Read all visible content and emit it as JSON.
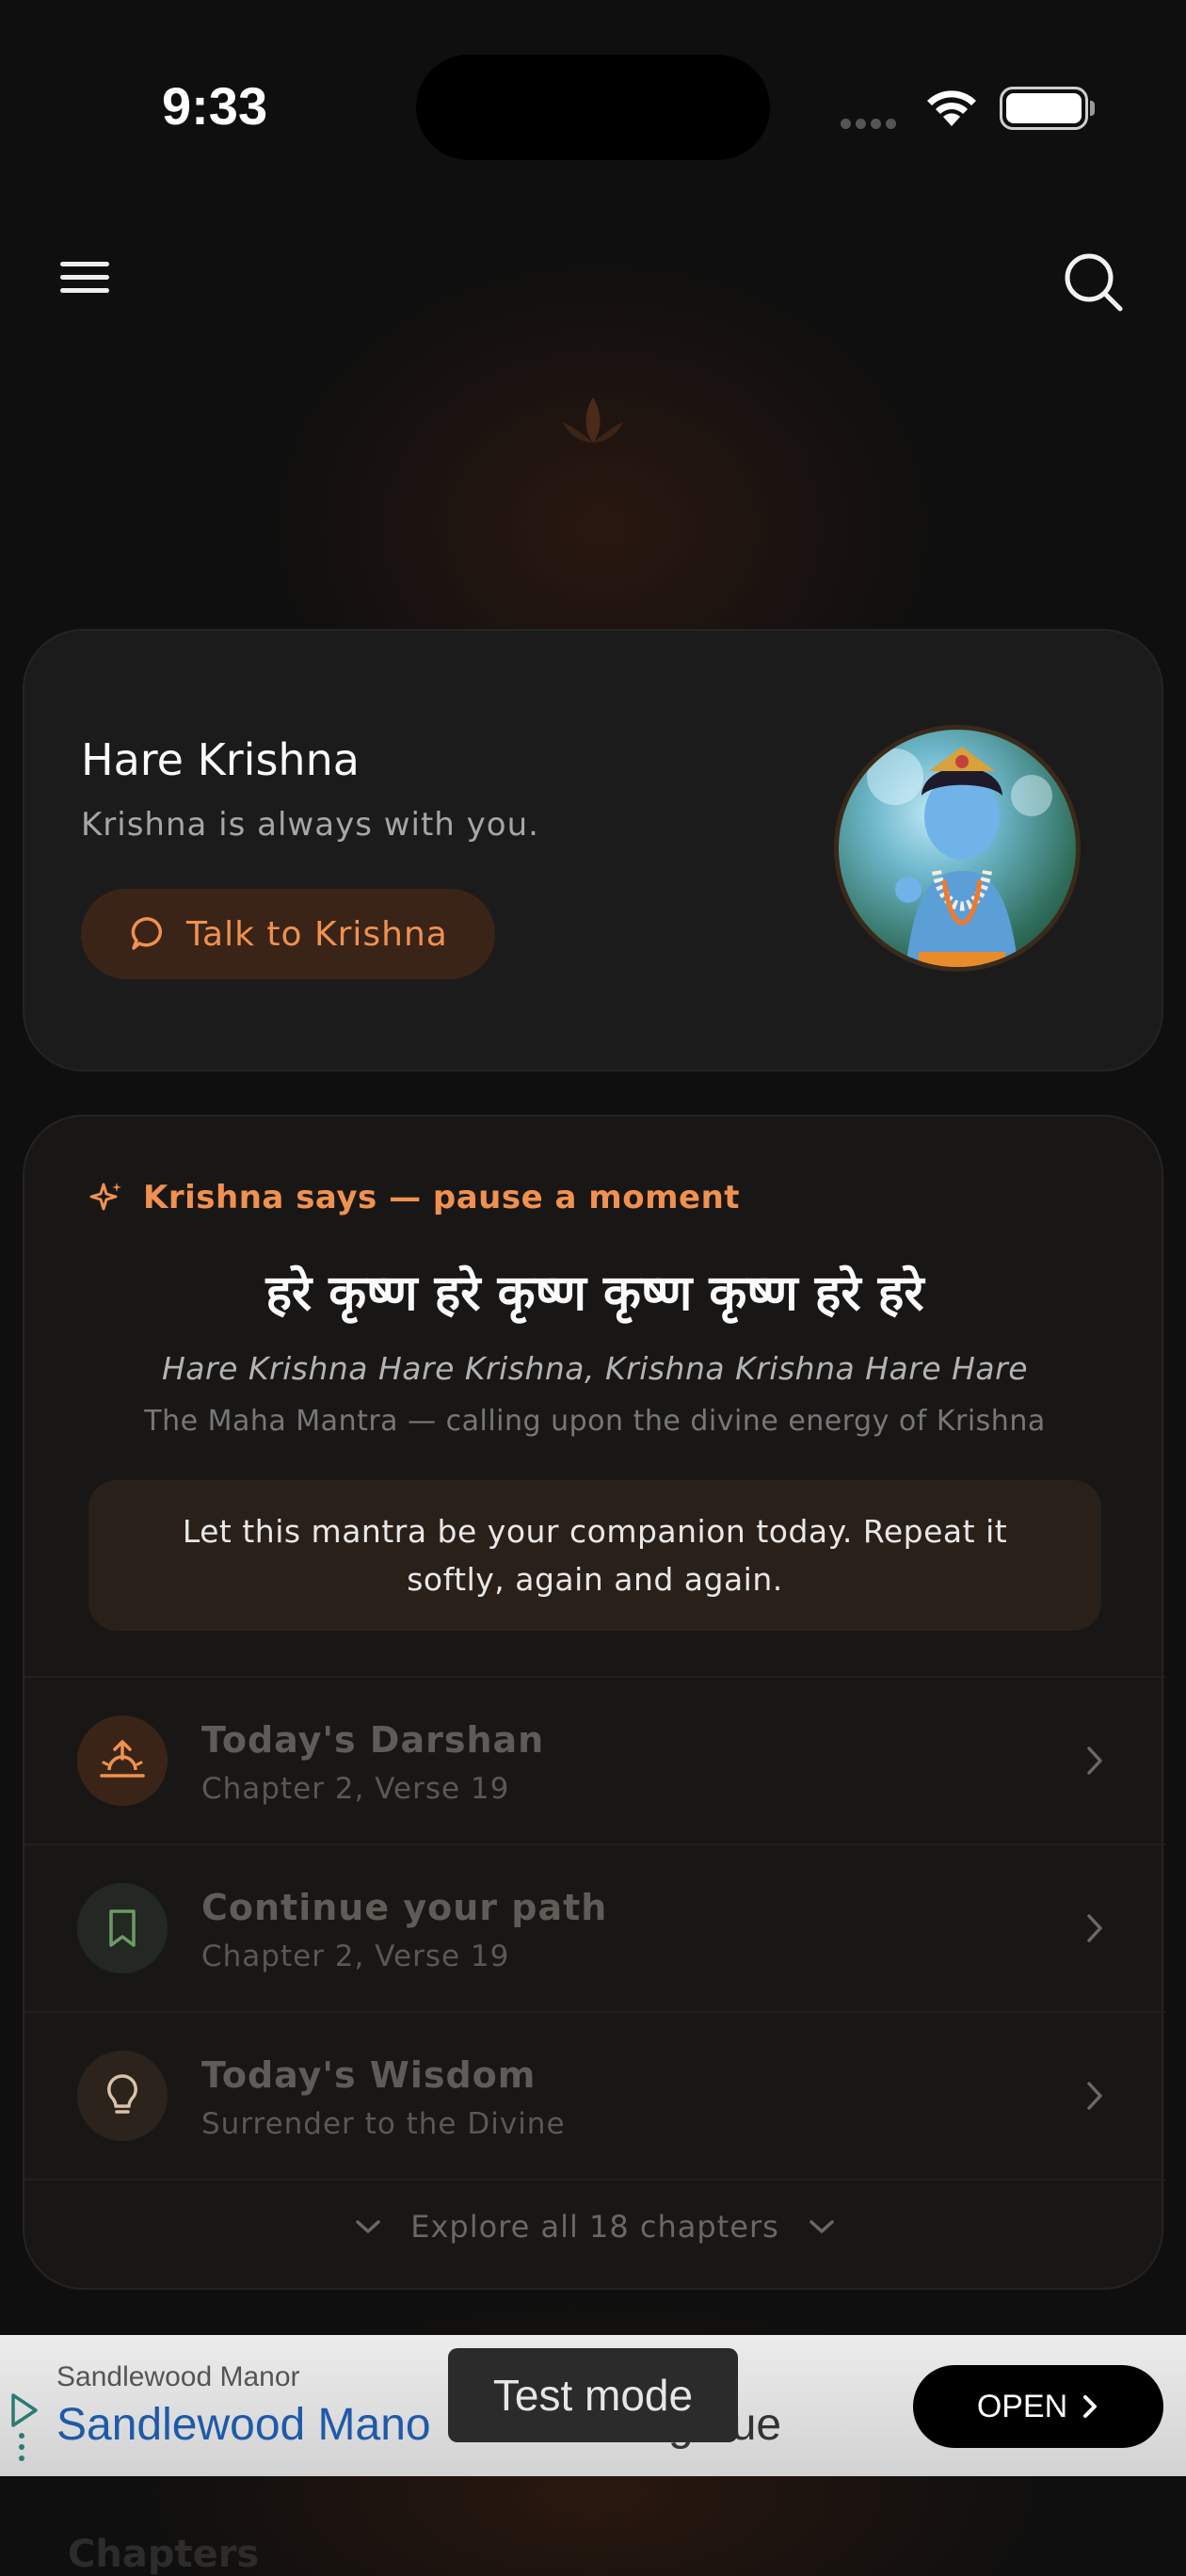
{
  "status_bar": {
    "time": "9:33"
  },
  "header": {
    "menu_icon": "menu-icon",
    "search_icon": "search-icon",
    "logo_icon": "lotus-icon"
  },
  "hero": {
    "title": "Hare Krishna",
    "subtitle": "Krishna is always with you.",
    "talk_button": "Talk to Krishna",
    "avatar_icon": "krishna-avatar"
  },
  "mantra": {
    "heading": "Krishna says — pause a moment",
    "devanagari": "हरे कृष्ण हरे कृष्ण कृष्ण कृष्ण हरे हरे",
    "transliteration": "Hare Krishna Hare Krishna, Krishna Krishna Hare Hare",
    "meaning": "The Maha Mantra — calling upon the divine energy of Krishna",
    "note": "Let this mantra be your companion today. Repeat it softly, again and again."
  },
  "rows": [
    {
      "title": "Today's Darshan",
      "subtitle": "Chapter 2, Verse 19",
      "icon": "sunrise-icon"
    },
    {
      "title": "Continue your path",
      "subtitle": "Chapter 2, Verse 19",
      "icon": "bookmark-icon"
    },
    {
      "title": "Today's Wisdom",
      "subtitle": "Surrender to the Divine",
      "icon": "lightbulb-icon"
    }
  ],
  "explore": {
    "label": "Explore all 18 chapters"
  },
  "ad": {
    "brand": "Sandlewood Manor",
    "title": "Sandlewood Mano",
    "title_tail": "g    nue",
    "open_button": "OPEN",
    "test_mode": "Test mode"
  },
  "peek": {
    "chapters_heading": "Chapters"
  },
  "colors": {
    "accent": "#f0914f",
    "background": "#0f0f0f",
    "card": "#1c1b1b"
  }
}
